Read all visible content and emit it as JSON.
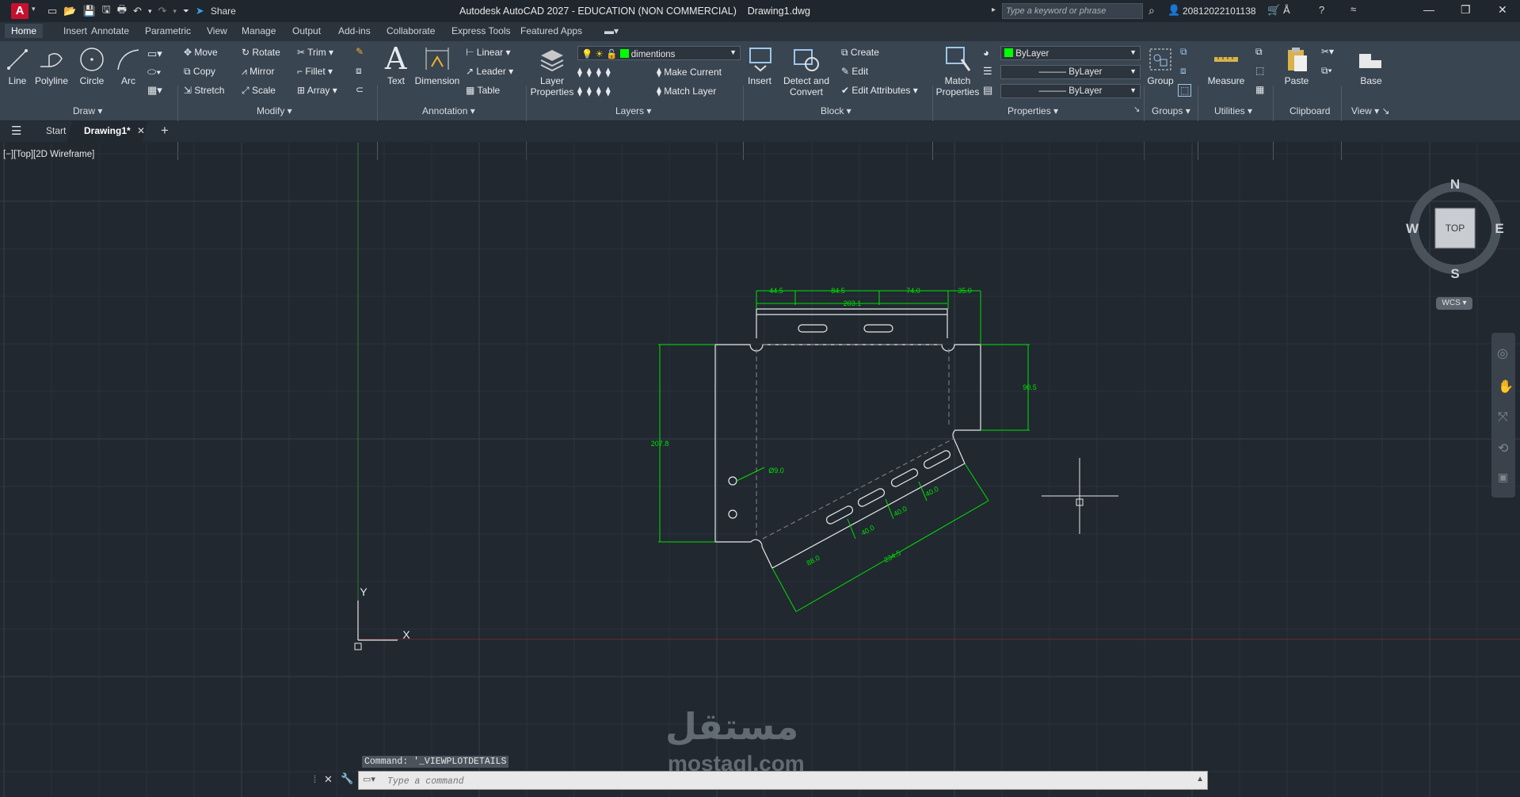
{
  "app": {
    "title": "Autodesk AutoCAD 2027 - EDUCATION (NON COMMERCIAL)",
    "document": "Drawing1.dwg",
    "logo_letter": "A",
    "share_label": "Share",
    "search_placeholder": "Type a keyword or phrase",
    "username": "20812022101138"
  },
  "ribbon_tabs": [
    "Home",
    "Insert",
    "Annotate",
    "Parametric",
    "View",
    "Manage",
    "Output",
    "Add-ins",
    "Collaborate",
    "Express Tools",
    "Featured Apps"
  ],
  "ribbon": {
    "draw": {
      "title": "Draw",
      "line": "Line",
      "polyline": "Polyline",
      "circle": "Circle",
      "arc": "Arc"
    },
    "modify": {
      "title": "Modify",
      "move": "Move",
      "rotate": "Rotate",
      "trim": "Trim",
      "copy": "Copy",
      "mirror": "Mirror",
      "fillet": "Fillet",
      "stretch": "Stretch",
      "scale": "Scale",
      "array": "Array"
    },
    "annotation": {
      "title": "Annotation",
      "text": "Text",
      "dimension": "Dimension",
      "linear": "Linear",
      "leader": "Leader",
      "table": "Table"
    },
    "layers": {
      "title": "Layers",
      "layer_properties_1": "Layer",
      "layer_properties_2": "Properties",
      "current_layer": "dimentions",
      "make_current": "Make Current",
      "match_layer": "Match Layer"
    },
    "block": {
      "title": "Block",
      "insert": "Insert",
      "detect_1": "Detect and",
      "detect_2": "Convert",
      "create": "Create",
      "edit": "Edit",
      "edit_attributes": "Edit Attributes"
    },
    "properties": {
      "title": "Properties",
      "match_1": "Match",
      "match_2": "Properties",
      "color": "ByLayer",
      "linetype": "ByLayer",
      "lineweight": "ByLayer"
    },
    "groups": {
      "title": "Groups",
      "group": "Group"
    },
    "utilities": {
      "title": "Utilities",
      "measure": "Measure"
    },
    "clipboard": {
      "title": "Clipboard",
      "paste": "Paste"
    },
    "view": {
      "title": "View",
      "base": "Base"
    }
  },
  "file_tabs": {
    "start": "Start",
    "drawing": "Drawing1*"
  },
  "viewport": {
    "label": "[−][Top][2D Wireframe]",
    "compass": {
      "n": "N",
      "s": "S",
      "e": "E",
      "w": "W",
      "cube": "TOP",
      "ucs": "WCS"
    },
    "axes": {
      "x": "X",
      "y": "Y"
    }
  },
  "dimensions": {
    "d1": "44.5",
    "d2": "84.5",
    "d3": "74.0",
    "d4": "35.0",
    "overall_top": "203.1",
    "height_left": "207.8",
    "height_right": "90.5",
    "hole_dia": "Ø9.0",
    "slot1": "40.0",
    "slot2": "40.0",
    "slot3": "40.0",
    "tab_short": "88.0",
    "tab_long": "234.5"
  },
  "command": {
    "history": "Command: '_VIEWPLOTDETAILS",
    "placeholder": "Type a command"
  },
  "watermark": {
    "arabic": "مستقل",
    "latin": "mostaql.com"
  },
  "colors": {
    "accent": "#0696d7",
    "dim": "#00ff00",
    "geometry": "#ffffff",
    "background": "#212830"
  }
}
